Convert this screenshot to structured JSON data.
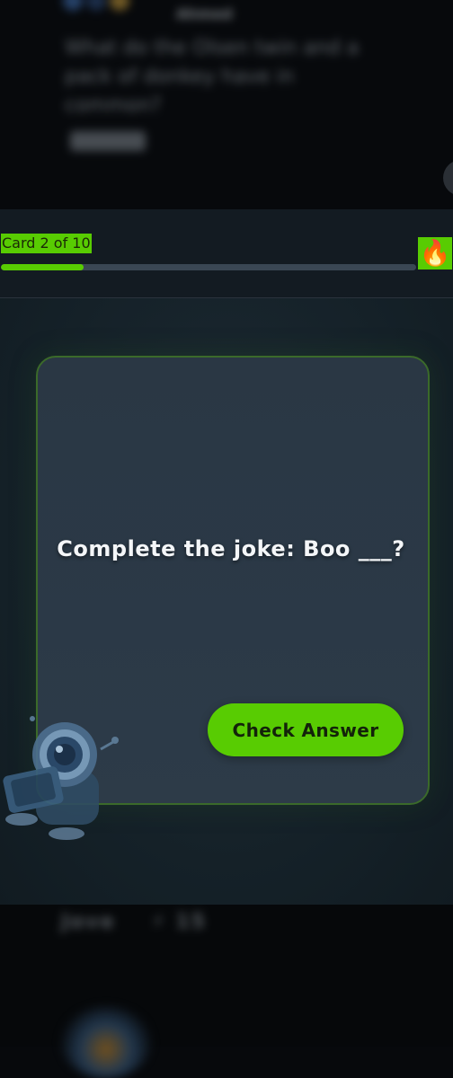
{
  "feed": {
    "top_user_name": "Ahmed",
    "top_post_text": "What do the Olsen twin and a pack of donkey have in common?",
    "top_post_chip": "Reveal",
    "bottom_user_name": "Jove",
    "bottom_points": "⚡ 15"
  },
  "header": {
    "card_counter": "Card 2 of 10",
    "progress_fraction": 0.2,
    "streak_icon": "🔥"
  },
  "card": {
    "question": "Complete the joke: Boo ___?",
    "check_button_label": "Check Answer"
  },
  "colors": {
    "accent": "#58cc02",
    "card_bg": "#2b3947",
    "header_bg": "#131b22"
  },
  "icons": {
    "streak": "fire-icon",
    "mascot": "robot-mascot-icon"
  }
}
